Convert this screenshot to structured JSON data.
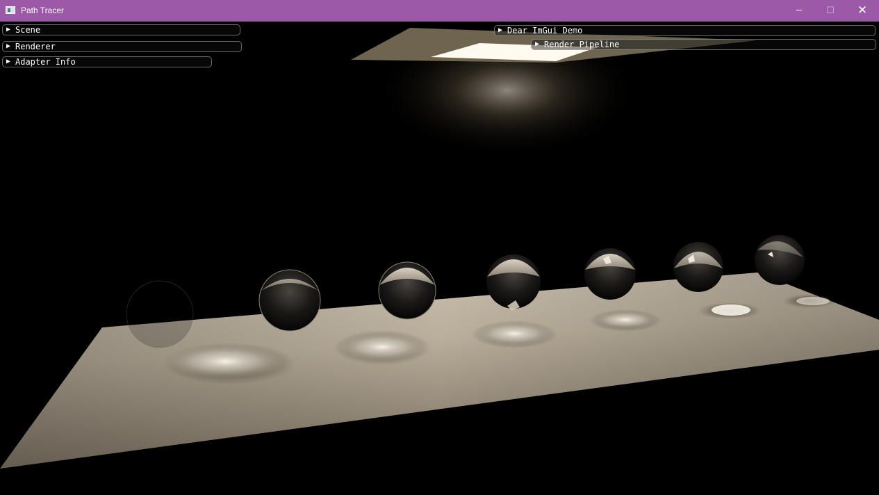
{
  "window": {
    "title": "Path Tracer",
    "controls": {
      "minimize": "─",
      "maximize": "☐",
      "close": "✕"
    }
  },
  "imgui": {
    "arrow": "▶",
    "left_headers": [
      "Scene",
      "Renderer",
      "Adapter Info"
    ],
    "right_headers": [
      "Dear ImGui Demo",
      "Render Pipeline"
    ]
  },
  "colors": {
    "titlebar": "#9b59a8",
    "floor": "#c2b8a6",
    "background": "#000000"
  }
}
